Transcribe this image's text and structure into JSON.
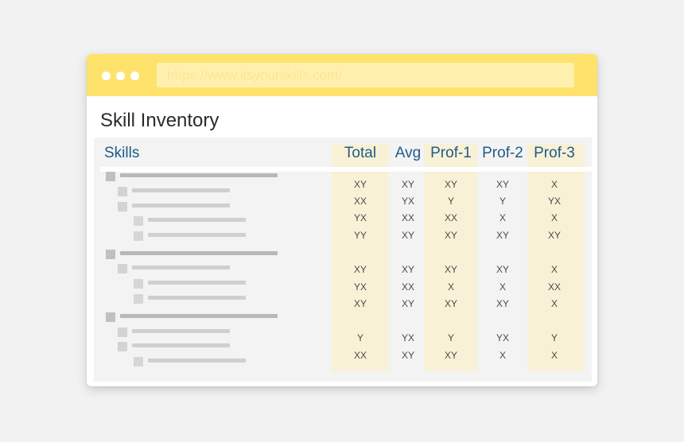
{
  "browser": {
    "url": "https://www.itsyourskills.com/"
  },
  "page": {
    "title": "Skill Inventory"
  },
  "table": {
    "skills_header": "Skills",
    "columns": [
      "Total",
      "Avg",
      "Prof-1",
      "Prof-2",
      "Prof-3"
    ],
    "tree_levels": [
      1,
      2,
      2,
      3,
      3,
      1,
      2,
      3,
      3,
      1,
      2,
      2,
      3
    ],
    "rows": [
      [
        "XY",
        "XY",
        "XY",
        "XY",
        "X"
      ],
      [
        "XX",
        "YX",
        "Y",
        "Y",
        "YX"
      ],
      [
        "YX",
        "XX",
        "XX",
        "X",
        "X"
      ],
      [
        "YY",
        "XY",
        "XY",
        "XY",
        "XY"
      ],
      [
        "XY",
        "XY",
        "XY",
        "XY",
        "X"
      ],
      [
        "YX",
        "XX",
        "X",
        "X",
        "XX"
      ],
      [
        "XY",
        "XY",
        "XY",
        "XY",
        "X"
      ],
      [
        "Y",
        "YX",
        "Y",
        "YX",
        "Y"
      ],
      [
        "XX",
        "XY",
        "XY",
        "X",
        "X"
      ]
    ]
  },
  "colors": {
    "titlebar": "#fee26b",
    "highlight_column": "#f9f1d6",
    "header_text": "#1d5c8a"
  }
}
